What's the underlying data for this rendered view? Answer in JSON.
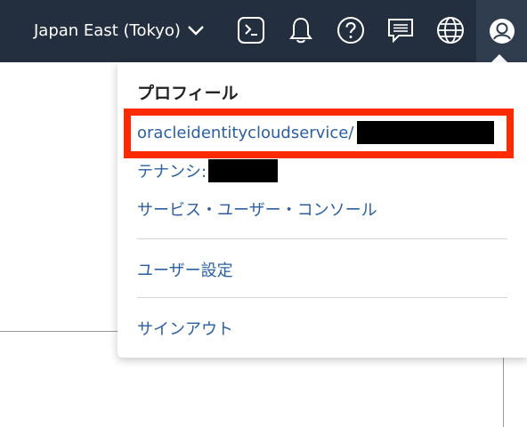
{
  "topbar": {
    "region_label": "Japan East (Tokyo)",
    "icons": [
      "cloud-shell-icon",
      "bell-icon",
      "help-icon",
      "chat-icon",
      "globe-icon",
      "user-profile-icon"
    ]
  },
  "profile_menu": {
    "title": "プロフィール",
    "username": "oracleidentitycloudservice/",
    "tenancy_label": "テナンシ:",
    "service_user_console": "サービス・ユーザー・コンソール",
    "user_settings": "ユーザー設定",
    "sign_out": "サインアウト"
  },
  "colors": {
    "topbar_bg": "#232f3e",
    "link": "#2b5fa0",
    "highlight_border": "#ff2a00",
    "redaction": "#000000"
  }
}
